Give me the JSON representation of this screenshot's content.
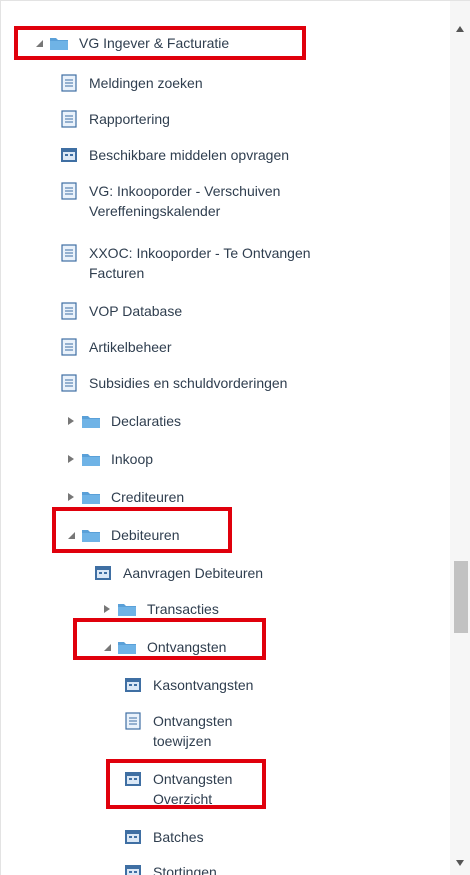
{
  "tree": {
    "items": [
      {
        "label": "VG Ingever & Facturatie"
      },
      {
        "label": "Meldingen zoeken"
      },
      {
        "label": "Rapportering"
      },
      {
        "label": "Beschikbare middelen opvragen"
      },
      {
        "label": "VG: Inkooporder - Verschuiven Vereffeningskalender"
      },
      {
        "label": "XXOC: Inkooporder - Te Ontvangen Facturen"
      },
      {
        "label": "VOP Database"
      },
      {
        "label": "Artikelbeheer"
      },
      {
        "label": "Subsidies en schuldvorderingen"
      },
      {
        "label": "Declaraties"
      },
      {
        "label": "Inkoop"
      },
      {
        "label": "Crediteuren"
      },
      {
        "label": "Debiteuren"
      },
      {
        "label": "Aanvragen Debiteuren"
      },
      {
        "label": "Transacties"
      },
      {
        "label": "Ontvangsten"
      },
      {
        "label": "Kasontvangsten"
      },
      {
        "label": "Ontvangsten toewijzen"
      },
      {
        "label": "Ontvangsten Overzicht"
      },
      {
        "label": "Batches"
      },
      {
        "label": "Stortingen"
      }
    ]
  },
  "colors": {
    "highlight": "#e0000c",
    "folder": "#5aa0d8",
    "doc": "#3f6fa3",
    "arrow": "#777777"
  }
}
